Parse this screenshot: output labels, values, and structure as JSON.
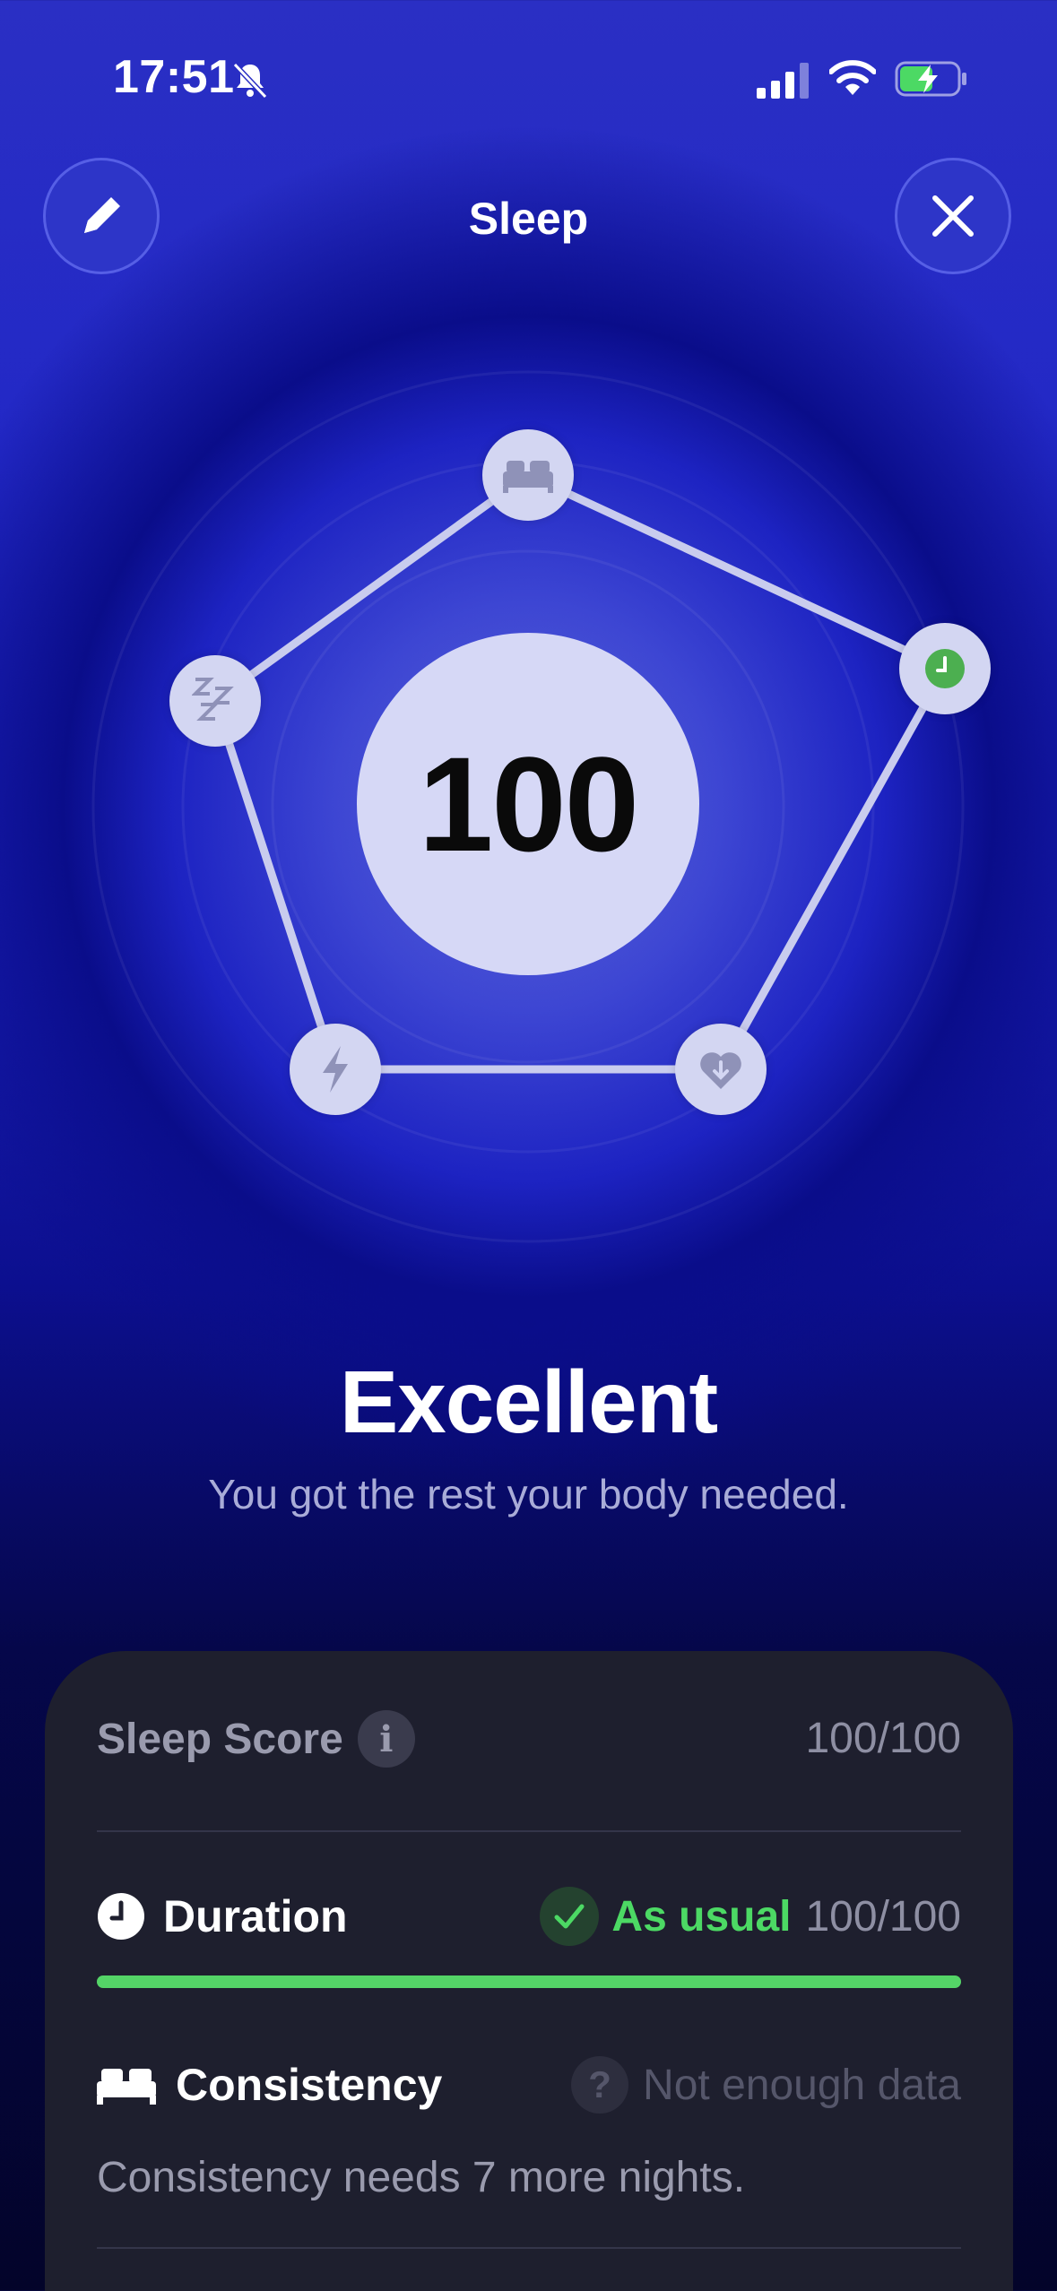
{
  "status_bar": {
    "time": "17:51"
  },
  "header": {
    "title": "Sleep"
  },
  "score": {
    "value": "100",
    "rating": "Excellent",
    "subtitle": "You got the rest your body needed."
  },
  "pentagon_nodes": [
    {
      "icon": "bed-icon"
    },
    {
      "icon": "clock-icon",
      "highlight_color": "#4caf50"
    },
    {
      "icon": "heart-rate-icon"
    },
    {
      "icon": "lightning-icon"
    },
    {
      "icon": "zzz-icon"
    }
  ],
  "card": {
    "sleep_score_label": "Sleep Score",
    "sleep_score_value": "100/100",
    "duration": {
      "label": "Duration",
      "status": "As usual",
      "score": "100/100",
      "progress": 1.0,
      "status_color": "#4cd964"
    },
    "consistency": {
      "label": "Consistency",
      "status": "Not enough data",
      "note": "Consistency needs 7 more nights."
    }
  }
}
